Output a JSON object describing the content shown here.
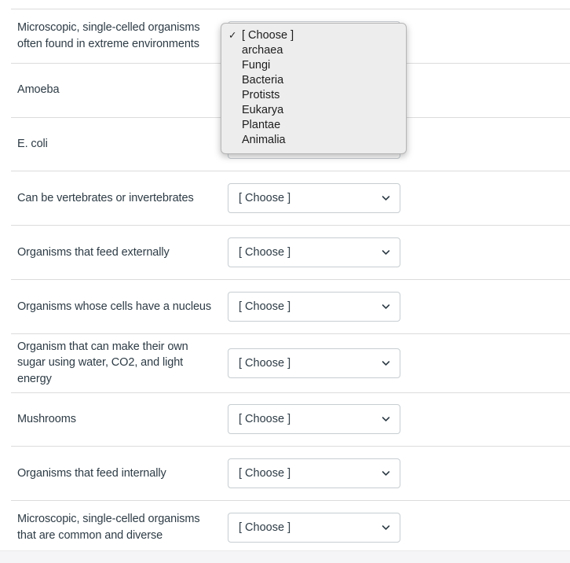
{
  "page": {
    "kind": "matching-question-list"
  },
  "colors": {
    "text": "#2d3b45",
    "divider": "#dcdcdc",
    "select_border": "#c7cdd1",
    "dropdown_bg": "#ededed",
    "dropdown_border": "#b6b6b6",
    "page_bg": "#ffffff",
    "footer_bg": "#f5f5f7"
  },
  "select_placeholder": "[ Choose ]",
  "chevron_icon": "chevron-down-icon",
  "rows": [
    {
      "label": "Microscopic, single-celled organisms often found in extreme environments",
      "value": "[ Choose ]",
      "open": true
    },
    {
      "label": "Amoeba",
      "value": "[ Choose ]",
      "open": false
    },
    {
      "label": "E. coli",
      "value": "[ Choose ]",
      "open": false
    },
    {
      "label": "Can be vertebrates or invertebrates",
      "value": "[ Choose ]",
      "open": false
    },
    {
      "label": "Organisms that feed externally",
      "value": "[ Choose ]",
      "open": false
    },
    {
      "label": "Organisms whose cells have a nucleus",
      "value": "[ Choose ]",
      "open": false
    },
    {
      "label": "Organism that can make their own sugar using water, CO2, and light energy",
      "value": "[ Choose ]",
      "open": false
    },
    {
      "label": "Mushrooms",
      "value": "[ Choose ]",
      "open": false
    },
    {
      "label": "Organisms that feed internally",
      "value": "[ Choose ]",
      "open": false
    },
    {
      "label": "Microscopic, single-celled organisms that are common and diverse",
      "value": "[ Choose ]",
      "open": false
    }
  ],
  "dropdown": {
    "selected_index": 0,
    "check_glyph": "✓",
    "options": [
      "[ Choose ]",
      "archaea",
      "Fungi",
      "Bacteria",
      "Protists",
      "Eukarya",
      "Plantae",
      "Animalia"
    ]
  }
}
